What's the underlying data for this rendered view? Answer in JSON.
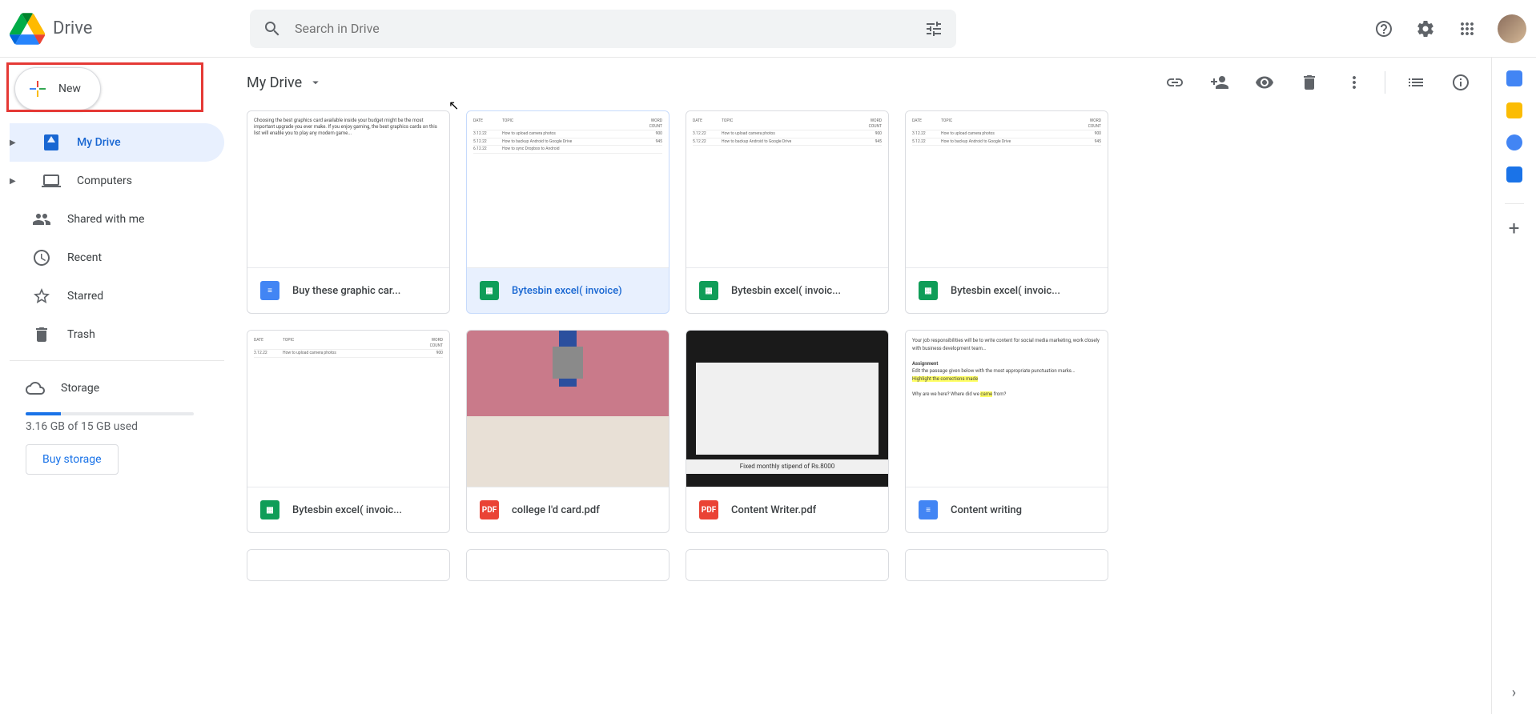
{
  "app": {
    "title": "Drive"
  },
  "search": {
    "placeholder": "Search in Drive"
  },
  "new_button": {
    "label": "New"
  },
  "sidebar": {
    "items": [
      {
        "label": "My Drive"
      },
      {
        "label": "Computers"
      },
      {
        "label": "Shared with me"
      },
      {
        "label": "Recent"
      },
      {
        "label": "Starred"
      },
      {
        "label": "Trash"
      }
    ]
  },
  "storage": {
    "label": "Storage",
    "usage": "3.16 GB of 15 GB used",
    "buy": "Buy storage"
  },
  "path": {
    "label": "My Drive"
  },
  "files": [
    {
      "name": "Buy these graphic car...",
      "type": "docs"
    },
    {
      "name": "Bytesbin excel( invoice)",
      "type": "sheets"
    },
    {
      "name": "Bytesbin excel( invoic...",
      "type": "sheets"
    },
    {
      "name": "Bytesbin excel( invoic...",
      "type": "sheets"
    },
    {
      "name": "Bytesbin excel( invoic...",
      "type": "sheets"
    },
    {
      "name": "college I'd card.pdf",
      "type": "pdf"
    },
    {
      "name": "Content Writer.pdf",
      "type": "pdf"
    },
    {
      "name": "Content writing",
      "type": "docs"
    }
  ],
  "thumb_dark_caption": "Fixed monthly stipend of Rs.8000"
}
